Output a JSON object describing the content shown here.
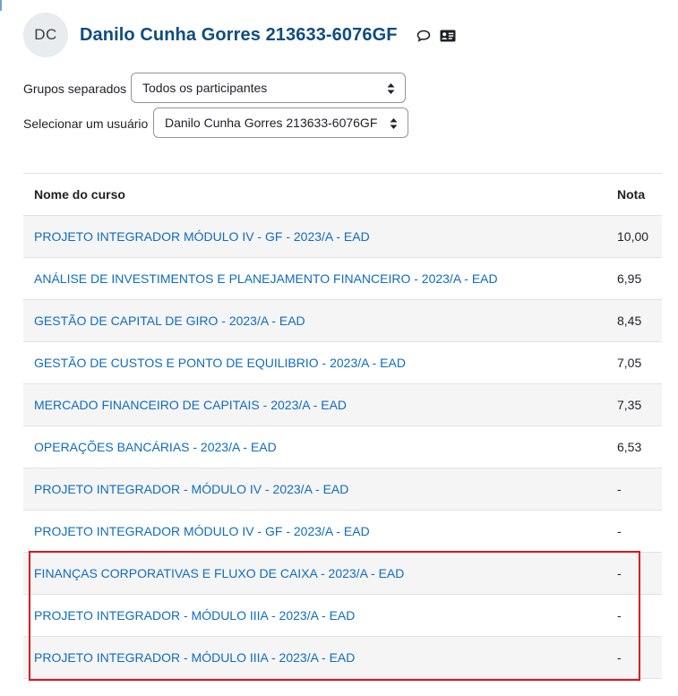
{
  "user": {
    "initials": "DC",
    "name": "Danilo Cunha Gorres 213633-6076GF"
  },
  "icons": {
    "message": "message-icon",
    "profile": "contact-card-icon"
  },
  "filters": {
    "group_label": "Grupos separados",
    "group_value": "Todos os participantes",
    "user_label": "Selecionar um usuário",
    "user_value": "Danilo Cunha Gorres 213633-6076GF"
  },
  "table": {
    "headers": {
      "course": "Nome do curso",
      "grade": "Nota"
    },
    "rows": [
      {
        "course": "PROJETO INTEGRADOR MÓDULO IV - GF - 2023/A - EAD",
        "grade": "10,00"
      },
      {
        "course": "ANÁLISE DE INVESTIMENTOS E PLANEJAMENTO FINANCEIRO - 2023/A - EAD",
        "grade": "6,95"
      },
      {
        "course": "GESTÃO DE CAPITAL DE GIRO - 2023/A - EAD",
        "grade": "8,45"
      },
      {
        "course": "GESTÃO DE CUSTOS E PONTO DE EQUILIBRIO - 2023/A - EAD",
        "grade": "7,05"
      },
      {
        "course": "MERCADO FINANCEIRO DE CAPITAIS - 2023/A - EAD",
        "grade": "7,35"
      },
      {
        "course": "OPERAÇÕES BANCÁRIAS - 2023/A - EAD",
        "grade": "6,53"
      },
      {
        "course": "PROJETO INTEGRADOR - MÓDULO IV - 2023/A - EAD",
        "grade": "-"
      },
      {
        "course": "PROJETO INTEGRADOR MÓDULO IV - GF - 2023/A - EAD",
        "grade": "-"
      },
      {
        "course": "FINANÇAS CORPORATIVAS E FLUXO DE CAIXA - 2023/A - EAD",
        "grade": "-"
      },
      {
        "course": "PROJETO INTEGRADOR - MÓDULO IIIA - 2023/A - EAD",
        "grade": "-"
      },
      {
        "course": "PROJETO INTEGRADOR - MÓDULO IIIA - 2023/A - EAD",
        "grade": "-"
      }
    ]
  },
  "colors": {
    "link": "#0f6cbf",
    "title": "#0f4c81",
    "highlight": "#e0141e"
  }
}
